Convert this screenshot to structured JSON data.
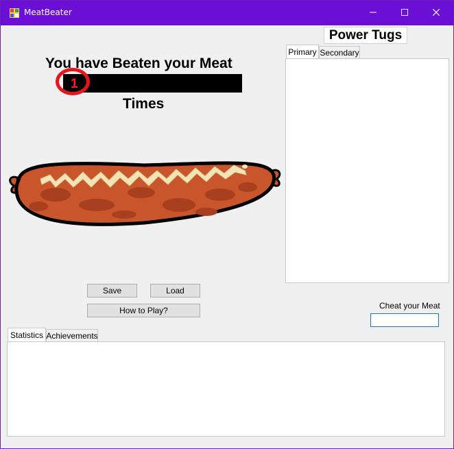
{
  "window": {
    "title": "MeatBeater",
    "icon": "app-icon",
    "controls": [
      "minimize-icon",
      "maximize-icon",
      "close-icon"
    ],
    "accent_color": "#6c0fd6"
  },
  "main": {
    "heading": "You have Beaten your Meat",
    "counter_value": "1",
    "times_label": "Times",
    "image": "sausage-illustration"
  },
  "buttons": {
    "save": "Save",
    "load": "Load",
    "how_to_play": "How to Play?"
  },
  "power_tugs": {
    "title": "Power Tugs",
    "tabs": [
      "Primary",
      "Secondary"
    ],
    "active_tab": "Primary"
  },
  "cheat": {
    "label": "Cheat your Meat",
    "value": ""
  },
  "bottom_tabs": {
    "tabs": [
      "Statistics",
      "Achievements"
    ],
    "active_tab": "Statistics"
  },
  "colors": {
    "counter_background": "#000000",
    "counter_text": "#ff2020",
    "annotation_circle": "#e8141b"
  }
}
